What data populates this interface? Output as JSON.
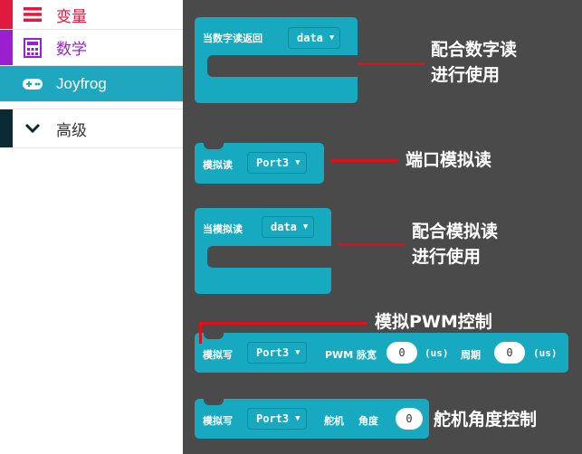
{
  "sidebar": {
    "items": [
      {
        "label": "变量",
        "color": "#e0193e",
        "icon": "list-icon"
      },
      {
        "label": "数学",
        "color": "#9b1fd0",
        "icon": "calculator-icon"
      },
      {
        "label": "Joyfrog",
        "color": "#1fa7bf",
        "icon": "gamepad-icon",
        "active": true
      },
      {
        "label": "高级",
        "color": "#0a2b33",
        "icon": "chevron-down-icon"
      }
    ]
  },
  "blocks": {
    "digital_read": {
      "label": "当数字读返回",
      "dropdown": "data"
    },
    "analog_read": {
      "label": "模拟读",
      "dropdown": "Port3"
    },
    "on_analog_read": {
      "label": "当模拟读",
      "dropdown": "data"
    },
    "analog_write": {
      "label": "模拟写",
      "dropdown": "Port3",
      "pulse_label": "PWM 脉宽",
      "pulse_value": "0",
      "pulse_unit": "(us)",
      "period_label": "周期",
      "period_value": "0",
      "period_unit": "(us)"
    },
    "servo_write": {
      "label": "模拟写",
      "dropdown": "Port3",
      "servo_label": "舵机",
      "angle_label": "角度",
      "angle_value": "0"
    }
  },
  "annotations": {
    "digital_read_line1": "配合数字读",
    "digital_read_line2": "进行使用",
    "port_analog_read": "端口模拟读",
    "analog_read_line1": "配合模拟读",
    "analog_read_line2": "进行使用",
    "pwm_control": "模拟PWM控制",
    "servo_angle_control": "舵机角度控制"
  },
  "colors": {
    "block": "#17a9bf",
    "workspace": "#4a4a4a",
    "annotation_line": "#e0101a"
  }
}
